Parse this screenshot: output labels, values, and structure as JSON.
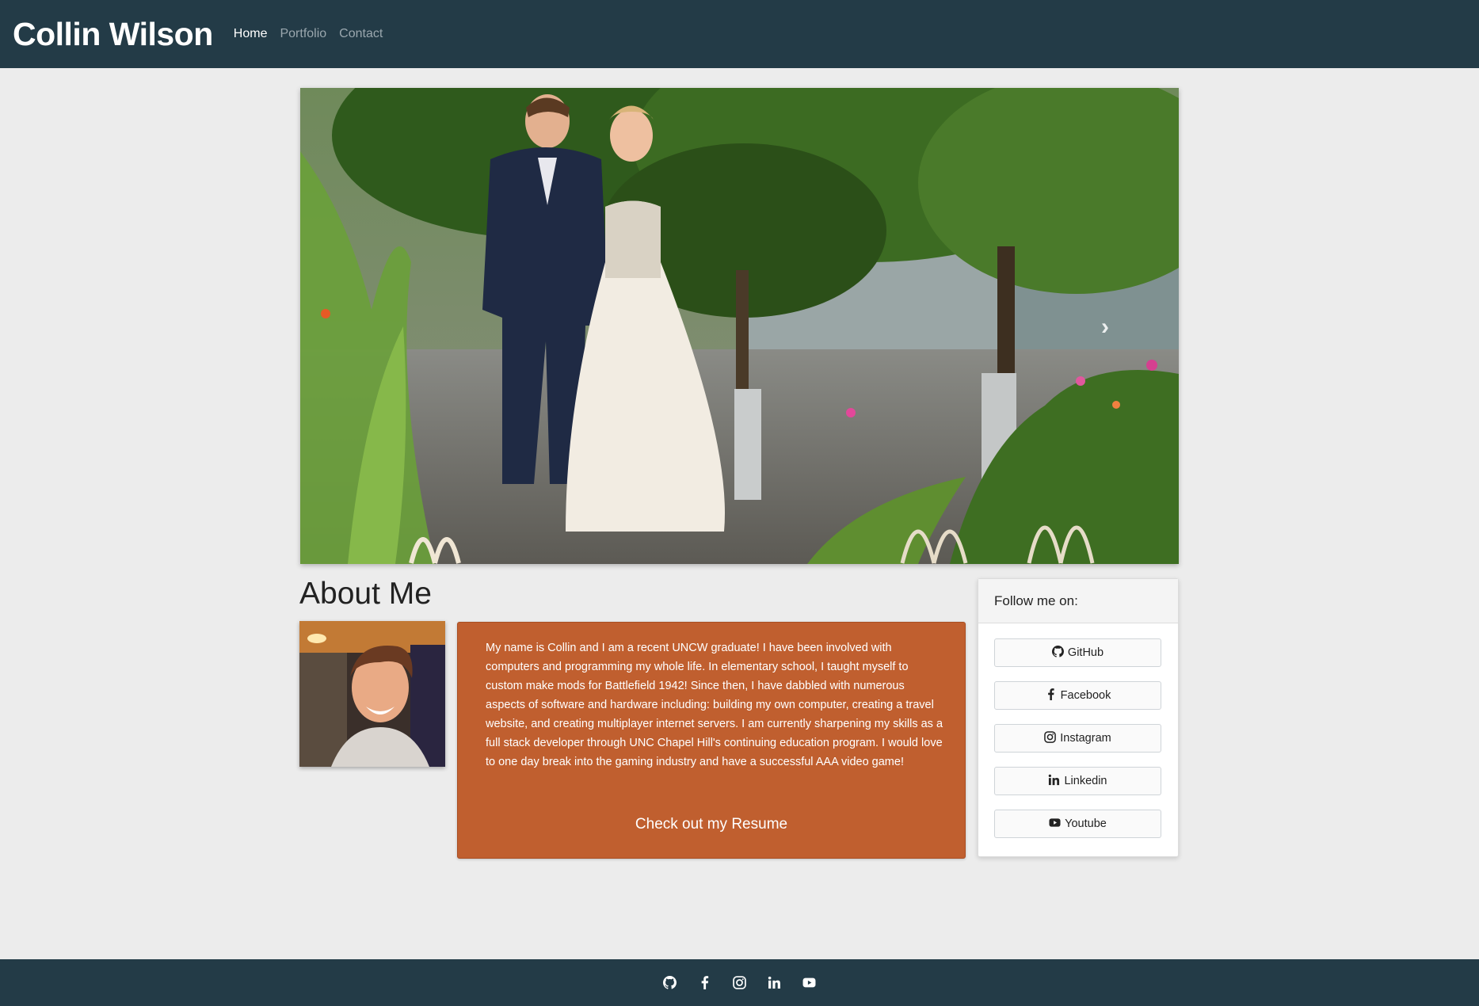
{
  "nav": {
    "brand": "Collin Wilson",
    "links": [
      {
        "label": "Home",
        "active": true
      },
      {
        "label": "Portfolio",
        "active": false
      },
      {
        "label": "Contact",
        "active": false
      }
    ]
  },
  "hero": {
    "next_icon": "chevron-right-icon"
  },
  "about": {
    "title": "About Me",
    "bio": "My name is Collin and I am a recent UNCW graduate! I have been involved with computers and programming my whole life. In elementary school, I taught myself to custom make mods for Battlefield 1942! Since then, I have dabbled with numerous aspects of software and hardware including: building my own computer, creating a travel website, and creating multiplayer internet servers. I am currently sharpening my skills as a full stack developer through UNC Chapel Hill's continuing education program. I would love to one day break into the gaming industry and have a successful AAA video game!",
    "resume_label": "Check out my Resume"
  },
  "follow": {
    "header": "Follow me on:",
    "buttons": [
      {
        "label": "GitHub",
        "icon": "github-icon"
      },
      {
        "label": "Facebook",
        "icon": "facebook-icon"
      },
      {
        "label": "Instagram",
        "icon": "instagram-icon"
      },
      {
        "label": "Linkedin",
        "icon": "linkedin-icon"
      },
      {
        "label": "Youtube",
        "icon": "youtube-icon"
      }
    ]
  },
  "footer": {
    "icons": [
      "github-icon",
      "facebook-icon",
      "instagram-icon",
      "linkedin-icon",
      "youtube-icon"
    ]
  },
  "colors": {
    "navbar": "#233b47",
    "page_bg": "#ececec",
    "bio_card": "#c05f2f"
  }
}
